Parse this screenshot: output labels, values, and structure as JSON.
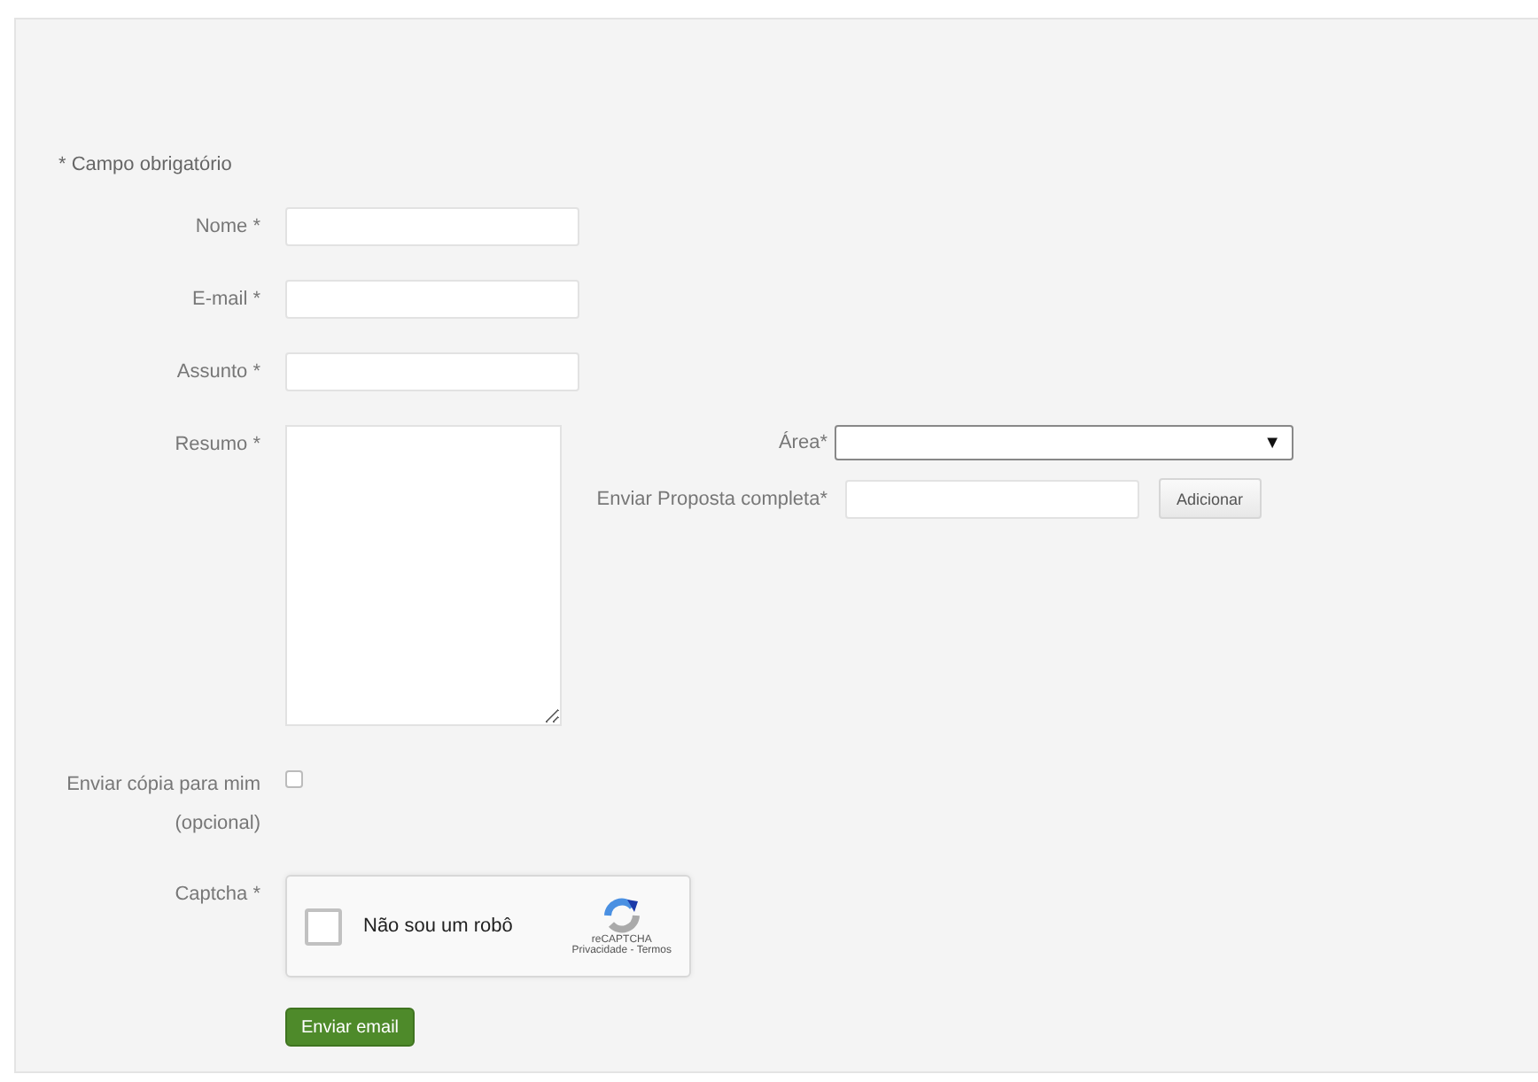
{
  "required_note": "* Campo obrigatório",
  "fields": [
    {
      "label": "Nome *",
      "kind": "text"
    },
    {
      "label": "E-mail *",
      "kind": "text"
    },
    {
      "label": "Assunto *",
      "kind": "text"
    },
    {
      "label": "Resumo *",
      "kind": "textarea"
    }
  ],
  "area": {
    "label": "Área*",
    "arrow": "▼"
  },
  "proposal": {
    "label": "Enviar Proposta completa*",
    "button": "Adicionar"
  },
  "copy": {
    "label": "Enviar cópia para mim",
    "note": "(opcional)",
    "checked": false
  },
  "captcha": {
    "label": "Captcha *",
    "text": "Não sou um robô",
    "checked": false,
    "brand": "reCAPTCHA",
    "links": "Privacidade - Termos"
  },
  "submit": "Enviar email"
}
